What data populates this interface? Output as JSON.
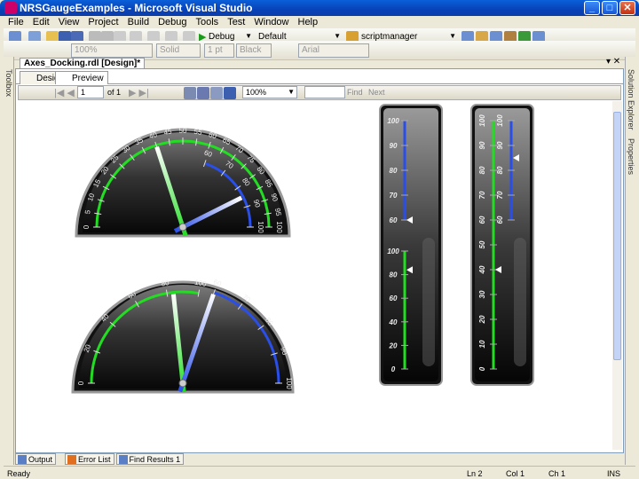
{
  "window": {
    "title": "NRSGaugeExamples - Microsoft Visual Studio"
  },
  "menu": [
    "File",
    "Edit",
    "View",
    "Project",
    "Build",
    "Debug",
    "Tools",
    "Test",
    "Window",
    "Help"
  ],
  "toolbar": {
    "config": "Debug",
    "platform": "Default",
    "startup": "scriptmanager",
    "zoom": "100%",
    "line_style": "Solid",
    "line_width": "1 pt",
    "color": "Black",
    "font": "Arial"
  },
  "document": {
    "tab": "Axes_Docking.rdl [Design]*",
    "subtabs": [
      "Design",
      "Preview"
    ]
  },
  "report_toolbar": {
    "page": "1",
    "of": "of 1",
    "zoom": "100%",
    "find": "Find",
    "next": "Next"
  },
  "side": {
    "left": "Toolbox",
    "right1": "Solution Explorer",
    "right2": "Properties"
  },
  "bottom_tabs": [
    "Output",
    "Error List",
    "Find Results 1"
  ],
  "status": {
    "text": "Ready",
    "ln": "Ln 2",
    "col": "Col 1",
    "ch": "Ch 1",
    "mode": "INS"
  },
  "gauges": {
    "radial": [
      {
        "scales": [
          {
            "color": "#22dd22",
            "min": 0,
            "max": 100,
            "step": 5,
            "start": 180,
            "end": 0,
            "r": 97,
            "pointer": 40
          },
          {
            "color": "#2a4ee8",
            "min": 60,
            "max": 100,
            "step": 10,
            "start": 71,
            "end": 0,
            "r": 76,
            "pointer": 85
          }
        ]
      },
      {
        "scales": [
          {
            "color": "#22dd22",
            "min": 0,
            "max": 100,
            "step": 20,
            "start": 180,
            "end": 80,
            "r": 103,
            "pointer": 84
          },
          {
            "color": "#2a4ee8",
            "min": 60,
            "max": 100,
            "step": 10,
            "start": 71,
            "end": 0,
            "r": 108,
            "pointer": 60
          }
        ]
      }
    ],
    "linear": [
      {
        "scales": [
          {
            "color": "#2a4ee8",
            "min": 60,
            "max": 100,
            "step": 10,
            "pointer": 60
          },
          {
            "color": "#22dd22",
            "min": 0,
            "max": 100,
            "step": 20,
            "pointer": 84
          }
        ]
      },
      {
        "scales": [
          {
            "color": "#22dd22",
            "min": 0,
            "max": 100,
            "step": 10,
            "pointer": 40
          },
          {
            "color": "#2a4ee8",
            "min": 60,
            "max": 100,
            "step": 10,
            "pointer": 85
          }
        ]
      }
    ]
  }
}
